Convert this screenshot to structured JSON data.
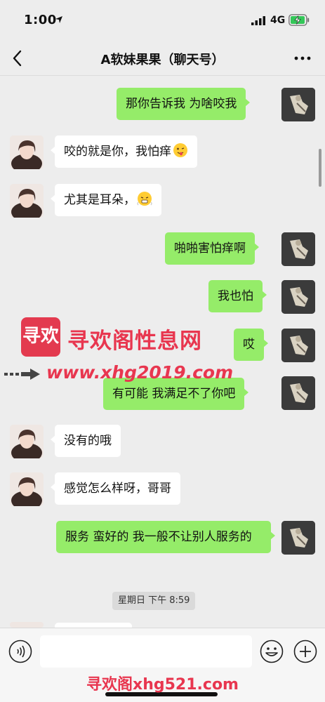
{
  "status_bar": {
    "time": "1:00",
    "network": "4G"
  },
  "header": {
    "title": "A软妹果果（聊天号）"
  },
  "messages": [
    {
      "side": "sent",
      "text": "那你告诉我 为啥咬我"
    },
    {
      "side": "recv",
      "text": "咬的就是你，我怕痒"
    },
    {
      "side": "recv",
      "text": "尤其是耳朵，"
    },
    {
      "side": "sent",
      "text": "啪啪害怕痒啊"
    },
    {
      "side": "sent",
      "text": "我也怕"
    },
    {
      "side": "sent",
      "text": "哎"
    },
    {
      "side": "sent",
      "text": "有可能 我满足不了你吧"
    },
    {
      "side": "recv",
      "text": "没有的哦"
    },
    {
      "side": "recv",
      "text": "感觉怎么样呀，哥哥"
    },
    {
      "side": "sent",
      "text": "服务 蛮好的 我一般不让别人服务的"
    }
  ],
  "timestamp": "星期日 下午 8:59",
  "watermarks": {
    "logo_text": "寻欢",
    "site_name": "寻欢阁性息网",
    "url": "www.xhg2019.com",
    "footer": "寻欢阁xhg521.com"
  },
  "colors": {
    "sent_bubble": "#95ec69",
    "recv_bubble": "#ffffff",
    "watermark": "#e8364f",
    "background": "#ededed"
  },
  "icons": [
    "back-chevron-icon",
    "more-dots-icon",
    "voice-icon",
    "emoji-icon",
    "plus-icon"
  ]
}
